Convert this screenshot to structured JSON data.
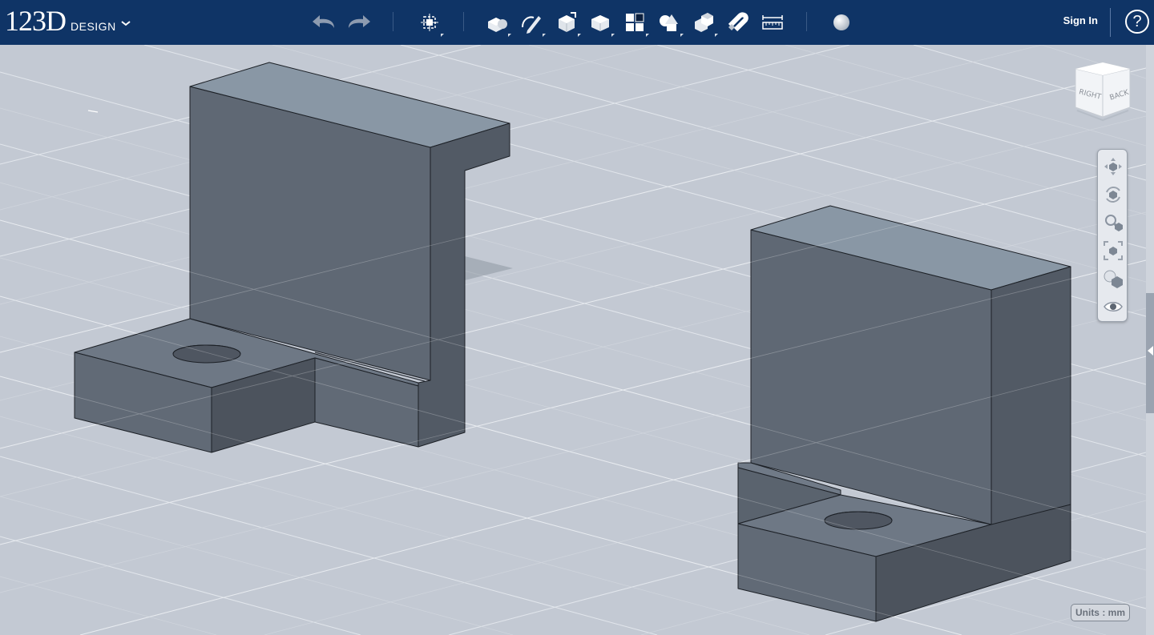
{
  "app": {
    "brand_number": "123D",
    "brand_word": "DESIGN"
  },
  "toolbar": {
    "undo_icon": "undo-arrow",
    "redo_icon": "redo-arrow",
    "items": [
      {
        "name": "transform-tool",
        "icon": "transform-icon"
      },
      {
        "name": "primitives-tool",
        "icon": "primitives-icon"
      },
      {
        "name": "sketch-tool",
        "icon": "sketch-icon"
      },
      {
        "name": "construct-tool",
        "icon": "construct-icon"
      },
      {
        "name": "modify-tool",
        "icon": "modify-icon"
      },
      {
        "name": "pattern-tool",
        "icon": "pattern-icon"
      },
      {
        "name": "grouping-tool",
        "icon": "grouping-icon"
      },
      {
        "name": "combine-tool",
        "icon": "combine-icon"
      },
      {
        "name": "snap-tool",
        "icon": "snap-icon"
      },
      {
        "name": "measure-tool",
        "icon": "measure-icon"
      },
      {
        "name": "material-tool",
        "icon": "material-sphere-icon"
      }
    ],
    "signin_label": "Sign In",
    "help_label": "?"
  },
  "viewcube": {
    "left_face": "RIGHT",
    "right_face": "BACK"
  },
  "navbar": {
    "items": [
      "pan-icon",
      "orbit-icon",
      "zoom-icon",
      "fit-icon",
      "view-mode-icon",
      "visibility-icon"
    ]
  },
  "units": {
    "label": "Units : mm"
  },
  "colors": {
    "topbar": "#0f3466",
    "viewport_bg": "#c3c9d3",
    "model_face_dark": "#5d6672",
    "model_face_top": "#8b98a6"
  }
}
